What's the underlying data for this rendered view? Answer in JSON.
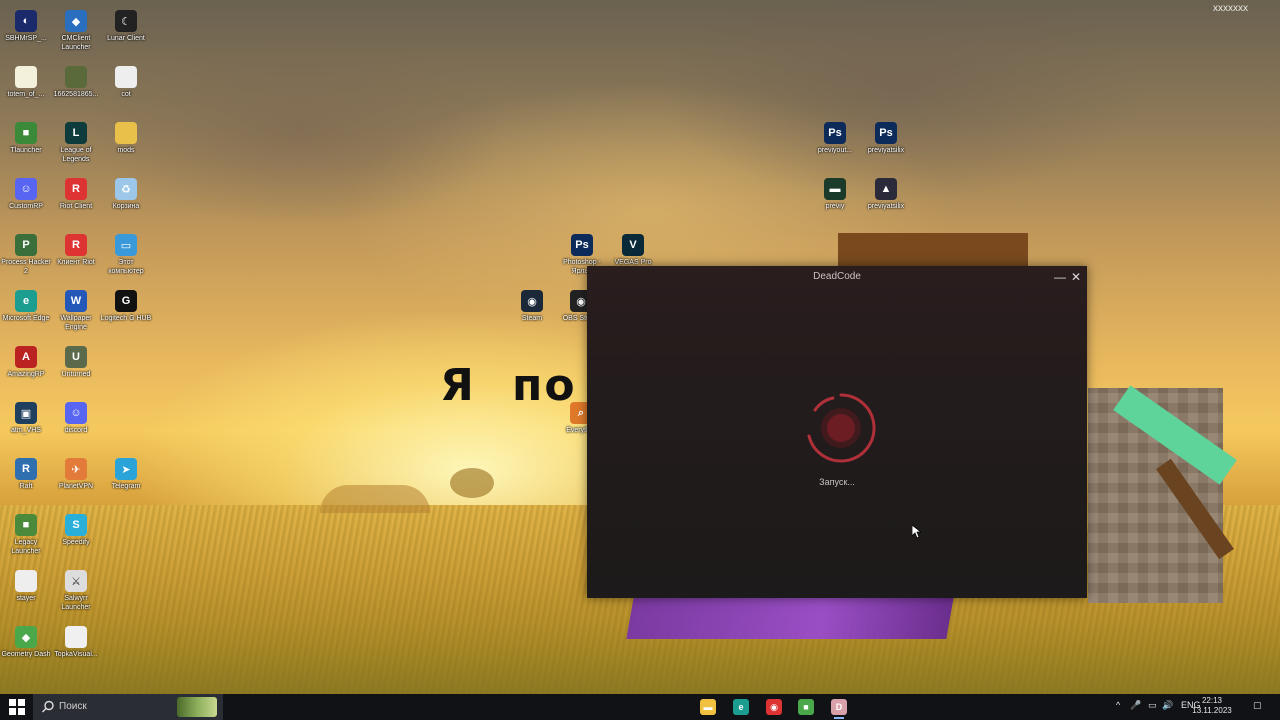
{
  "watermark": "xxxxxxx",
  "wallpaper_text": {
    "part1": "Я",
    "part2": "по"
  },
  "desktop_icons": [
    {
      "id": "d1",
      "label": "SBHMrSP_...",
      "color": "#1b2a6b",
      "glyph": "◐"
    },
    {
      "id": "d2",
      "label": "CMClient Launcher",
      "color": "#2a6fbf",
      "glyph": "◆"
    },
    {
      "id": "d3",
      "label": "Lunar Client",
      "color": "#222",
      "glyph": "☾"
    },
    {
      "id": "d4",
      "label": "totem_of_...",
      "color": "#f3f0dc",
      "glyph": ""
    },
    {
      "id": "d5",
      "label": "1662581865...",
      "color": "#5a6a3a",
      "glyph": ""
    },
    {
      "id": "d6",
      "label": "cot",
      "color": "#eeeeee",
      "glyph": ""
    },
    {
      "id": "d7",
      "label": "Tlauncher",
      "color": "#3a8a3a",
      "glyph": "■"
    },
    {
      "id": "d8",
      "label": "League of Legends",
      "color": "#0e3b3b",
      "glyph": "L"
    },
    {
      "id": "d9",
      "label": "mods",
      "color": "#e8c04a",
      "glyph": ""
    },
    {
      "id": "d10",
      "label": "CustomRP",
      "color": "#5865f2",
      "glyph": "☺"
    },
    {
      "id": "d11",
      "label": "Riot Client",
      "color": "#d33",
      "glyph": "R"
    },
    {
      "id": "d12",
      "label": "Корзина",
      "color": "#9cc7e8",
      "glyph": "♻"
    },
    {
      "id": "d13",
      "label": "Process Hacker 2",
      "color": "#3a6e3a",
      "glyph": "P"
    },
    {
      "id": "d14",
      "label": "Клиент Riot",
      "color": "#d33",
      "glyph": "R"
    },
    {
      "id": "d15",
      "label": "Этот компьютер",
      "color": "#3a9ad9",
      "glyph": "▭"
    },
    {
      "id": "d16",
      "label": "Microsoft Edge",
      "color": "#1b9e8f",
      "glyph": "e"
    },
    {
      "id": "d17",
      "label": "Wallpaper Engine",
      "color": "#2357b8",
      "glyph": "W"
    },
    {
      "id": "d18",
      "label": "Logitech G HUB",
      "color": "#111",
      "glyph": "G"
    },
    {
      "id": "d19",
      "label": "AmazingRP",
      "color": "#b22",
      "glyph": "A"
    },
    {
      "id": "d20",
      "label": "Unturned",
      "color": "#5a6a4a",
      "glyph": "U"
    },
    {
      "id": "d21",
      "label": "atm_VHS",
      "color": "#1f3f5f",
      "glyph": "▣"
    },
    {
      "id": "d22",
      "label": "discord",
      "color": "#5865f2",
      "glyph": "☺"
    },
    {
      "id": "d23",
      "label": "Raft",
      "color": "#2f6fb0",
      "glyph": "R"
    },
    {
      "id": "d24",
      "label": "PlanetVPN",
      "color": "#e27a3a",
      "glyph": "✈"
    },
    {
      "id": "d25",
      "label": "Telegram",
      "color": "#2aa3d8",
      "glyph": "➤"
    },
    {
      "id": "d26",
      "label": "Legacy Launcher",
      "color": "#4a8a3a",
      "glyph": "■"
    },
    {
      "id": "d27",
      "label": "Speedify",
      "color": "#2ab0d8",
      "glyph": "S"
    },
    {
      "id": "d28",
      "label": "stayer",
      "color": "#eeeeee",
      "glyph": ""
    },
    {
      "id": "d29",
      "label": "Salwyrr Launcher",
      "color": "#dddddd",
      "glyph": "⚔"
    },
    {
      "id": "d30",
      "label": "Geometry Dash",
      "color": "#4aa84a",
      "glyph": "◆"
    },
    {
      "id": "d31",
      "label": "TopkaVisual...",
      "color": "#f0f0f0",
      "glyph": ""
    },
    {
      "id": "d32",
      "label": "previyout...",
      "color": "#0c2a5a",
      "glyph": "Ps"
    },
    {
      "id": "d33",
      "label": "previyatsilix",
      "color": "#0c2a5a",
      "glyph": "Ps"
    },
    {
      "id": "d34",
      "label": "previy",
      "color": "#1a3a2a",
      "glyph": "▬"
    },
    {
      "id": "d35",
      "label": "previyatsilix",
      "color": "#2a2a3a",
      "glyph": "▲"
    },
    {
      "id": "d36",
      "label": "Photoshop - Ярлык",
      "color": "#0c2a5a",
      "glyph": "Ps"
    },
    {
      "id": "d37",
      "label": "VEGAS Pro",
      "color": "#0a2a3a",
      "glyph": "V"
    },
    {
      "id": "d38",
      "label": "Steam",
      "color": "#1b2838",
      "glyph": "◉"
    },
    {
      "id": "d39",
      "label": "OBS Studio",
      "color": "#222",
      "glyph": "◉"
    },
    {
      "id": "d40",
      "label": "Everyth...",
      "color": "#e07a2a",
      "glyph": "⌕"
    }
  ],
  "app_window": {
    "title": "DeadCode",
    "status": "Запуск...",
    "accent": "#b0303a",
    "minimize_glyph": "—",
    "close_glyph": "✕"
  },
  "taskbar": {
    "search_placeholder": "Поиск",
    "pinned": [
      {
        "name": "file-explorer",
        "color": "#f0c040",
        "glyph": "▬"
      },
      {
        "name": "edge",
        "color": "#1b9e8f",
        "glyph": "e"
      },
      {
        "name": "chrome-like",
        "color": "#d33",
        "glyph": "◉"
      },
      {
        "name": "minecraft",
        "color": "#4aa84a",
        "glyph": "■"
      },
      {
        "name": "deadcode",
        "color": "#d8a0a8",
        "glyph": "D"
      }
    ],
    "tray": {
      "chevron": "^",
      "mic": "🎤",
      "network": "▭",
      "volume": "🔊",
      "language": "ENG",
      "time": "22:13",
      "date": "13.11.2023",
      "notification_glyph": "▢"
    }
  }
}
